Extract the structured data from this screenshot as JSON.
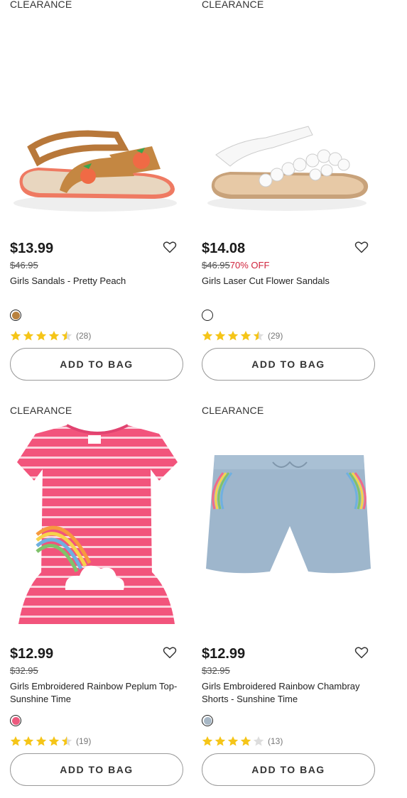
{
  "products": [
    {
      "badge": "CLEARANCE",
      "price": "$13.99",
      "original_price": "$46.95",
      "discount": "",
      "name": "Girls Sandals - Pretty Peach",
      "swatch_color": "#b9823f",
      "rating": 4.5,
      "review_count": "(28)",
      "button": "ADD TO BAG"
    },
    {
      "badge": "CLEARANCE",
      "price": "$14.08",
      "original_price": "$46.95",
      "discount": "70% OFF",
      "name": "Girls Laser Cut Flower Sandals",
      "swatch_color": "#ffffff",
      "rating": 4.5,
      "review_count": "(29)",
      "button": "ADD TO BAG"
    },
    {
      "badge": "CLEARANCE",
      "price": "$12.99",
      "original_price": "$32.95",
      "discount": "",
      "name": "Girls Embroidered Rainbow Peplum Top- Sunshine Time",
      "swatch_color": "#ec5a7e",
      "rating": 4.5,
      "review_count": "(19)",
      "button": "ADD TO BAG"
    },
    {
      "badge": "CLEARANCE",
      "price": "$12.99",
      "original_price": "$32.95",
      "discount": "",
      "name": "Girls Embroidered Rainbow Chambray Shorts - Sunshine Time",
      "swatch_color": "#a7b7c5",
      "rating": 4,
      "review_count": "(13)",
      "button": "ADD TO BAG"
    }
  ]
}
